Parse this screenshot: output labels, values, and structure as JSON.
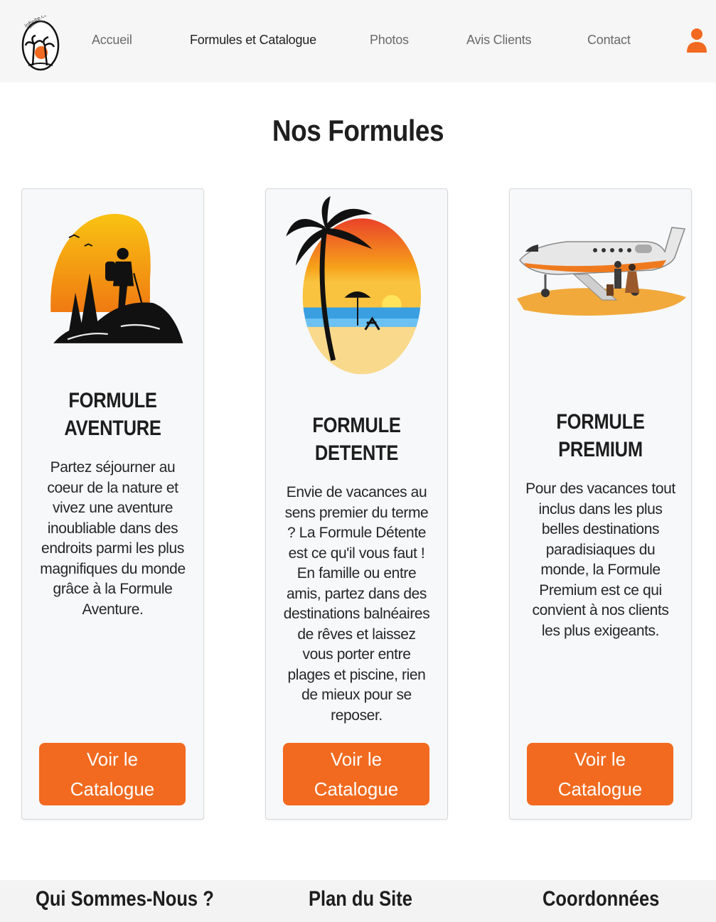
{
  "header": {
    "logo_alt": "infinite.corp",
    "nav": [
      "Accueil",
      "Formules et Catalogue",
      "Photos",
      "Avis Clients",
      "Contact"
    ],
    "active_nav": "Formules et Catalogue"
  },
  "main": {
    "title": "Nos Formules",
    "cards": [
      {
        "title_line1": "FORMULE",
        "title_line2": "AVENTURE",
        "description": "Partez séjourner au coeur de la nature et vivez une aventure inoubliable dans des endroits parmi les plus magnifiques du monde grâce à la Formule Aventure.",
        "button": "Voir le Catalogue",
        "image": "hiker-sunset-illustration"
      },
      {
        "title_line1": "FORMULE",
        "title_line2": "DETENTE",
        "description": "Envie de vacances au sens premier du terme ? La Formule Détente est ce qu'il vous faut ! En famille ou entre amis, partez dans des destinations balnéaires de rêves et laissez vous porter entre plages et piscine, rien de mieux pour se reposer.",
        "button": "Voir le Catalogue",
        "image": "palm-beach-sunset-illustration"
      },
      {
        "title_line1": "FORMULE",
        "title_line2": "PREMIUM",
        "description": "Pour des vacances tout inclus dans les plus belles destinations paradisiaques du monde, la Formule Premium est ce qui convient à nos clients les plus exigeants.",
        "button": "Voir le Catalogue",
        "image": "private-jet-illustration"
      }
    ]
  },
  "footer": {
    "columns": [
      "Qui Sommes-Nous ?",
      "Plan du Site",
      "Coordonnées"
    ]
  },
  "colors": {
    "accent": "#f26a1f",
    "header_bg": "#f6f6f6",
    "card_bg": "#f7f8fa"
  }
}
